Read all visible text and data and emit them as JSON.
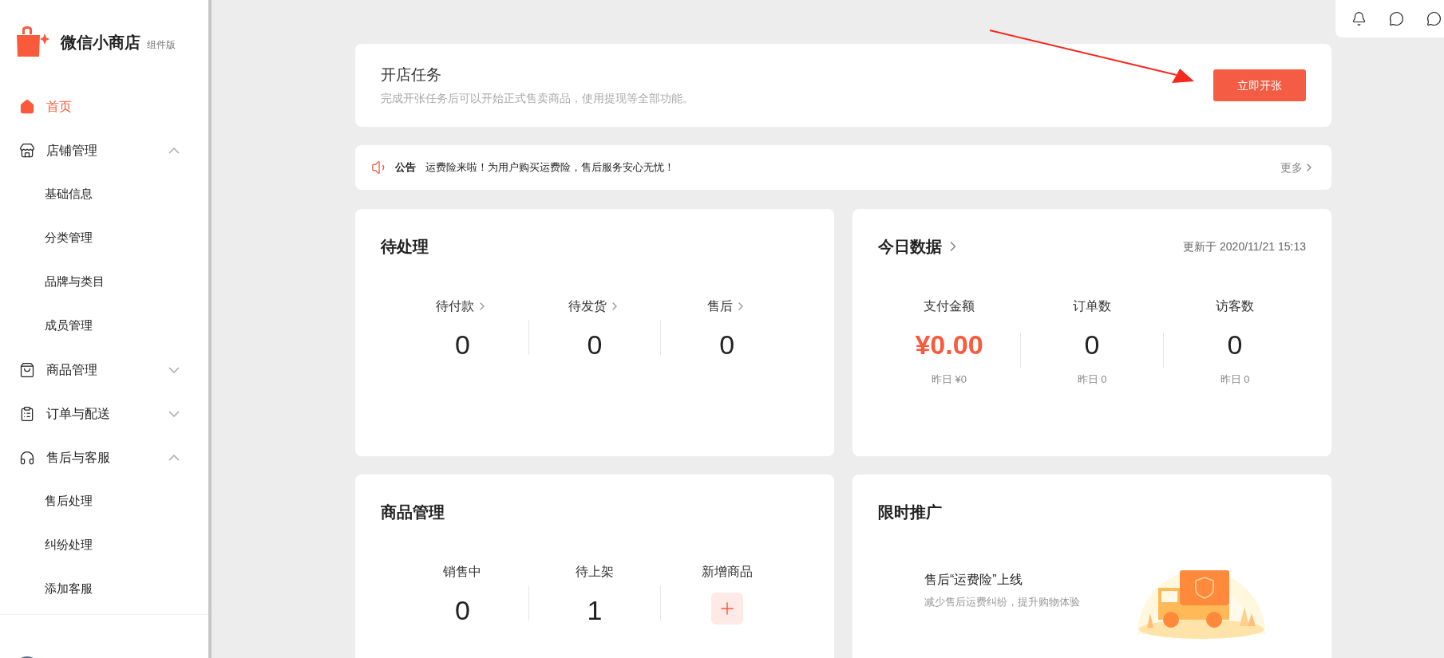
{
  "brand": {
    "title": "微信小商店",
    "edition": "组件版"
  },
  "sidebar": {
    "items": [
      {
        "label": "首页",
        "selected": true
      },
      {
        "label": "店铺管理",
        "selected": false,
        "expanded": true,
        "children": [
          {
            "label": "基础信息",
            "selected": false
          },
          {
            "label": "分类管理",
            "selected": false
          },
          {
            "label": "品牌与类目",
            "selected": false
          },
          {
            "label": "成员管理",
            "selected": false
          }
        ]
      },
      {
        "label": "商品管理",
        "selected": false,
        "expanded": false
      },
      {
        "label": "订单与配送",
        "selected": false,
        "expanded": false
      },
      {
        "label": "售后与客服",
        "selected": false,
        "expanded": true,
        "children": [
          {
            "label": "售后处理",
            "selected": false
          },
          {
            "label": "纠纷处理",
            "selected": false
          },
          {
            "label": "添加客服",
            "selected": false
          }
        ]
      }
    ]
  },
  "task": {
    "title": "开店任务",
    "description": "完成开张任务后可以开始正式售卖商品，使用提现等全部功能。",
    "button": "立即开张"
  },
  "notice": {
    "tag": "公告",
    "text": "运费险来啦！为用户购买运费险，售后服务安心无忧！",
    "more": "更多"
  },
  "pending": {
    "title": "待处理",
    "metrics": [
      {
        "label": "待付款",
        "value": "0"
      },
      {
        "label": "待发货",
        "value": "0"
      },
      {
        "label": "售后",
        "value": "0"
      }
    ]
  },
  "today": {
    "title": "今日数据",
    "updated": "更新于 2020/11/21 15:13",
    "metrics": [
      {
        "label": "支付金额",
        "value": "¥0.00",
        "sub": "昨日 ¥0",
        "highlight": true
      },
      {
        "label": "订单数",
        "value": "0",
        "sub": "昨日 0",
        "highlight": false
      },
      {
        "label": "访客数",
        "value": "0",
        "sub": "昨日 0",
        "highlight": false
      }
    ]
  },
  "products": {
    "title": "商品管理",
    "metrics": [
      {
        "kind": "count",
        "label": "销售中",
        "value": "0"
      },
      {
        "kind": "count",
        "label": "待上架",
        "value": "1"
      },
      {
        "kind": "add",
        "label": "新增商品"
      }
    ]
  },
  "promo": {
    "title": "限时推广",
    "headline": "售后“运费险”上线",
    "subline": "减少售后运费纠纷，提升购物体验"
  }
}
